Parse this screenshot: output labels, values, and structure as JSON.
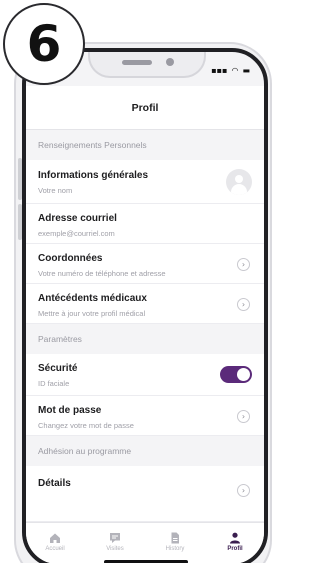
{
  "step": {
    "number": "6"
  },
  "header": {
    "title": "Profil"
  },
  "sections": {
    "personal": "Renseignements Personnels",
    "settings": "Paramètres",
    "membership": "Adhésion au programme"
  },
  "rows": {
    "general": {
      "label": "Informations générales",
      "sub": "Votre nom"
    },
    "email": {
      "label": "Adresse courriel",
      "sub": "exemple@courriel.com"
    },
    "contact": {
      "label": "Coordonnées",
      "sub": "Votre numéro de téléphone et adresse"
    },
    "medical": {
      "label": "Antécédents médicaux",
      "sub": "Mettre à jour votre profil médical"
    },
    "security": {
      "label": "Sécurité",
      "sub": "ID faciale",
      "toggle_on": true
    },
    "password": {
      "label": "Mot de passe",
      "sub": "Changez votre mot de passe"
    },
    "details": {
      "label": "Détails"
    }
  },
  "tabs": [
    {
      "label": "Accueil",
      "icon": "home-icon"
    },
    {
      "label": "Visites",
      "icon": "chat-icon"
    },
    {
      "label": "History",
      "icon": "document-icon"
    },
    {
      "label": "Profil",
      "icon": "person-icon",
      "active": true
    }
  ],
  "colors": {
    "accent": "#5b2a7a",
    "active_tab": "#3a1e4f",
    "inactive": "#b3b3ba"
  }
}
